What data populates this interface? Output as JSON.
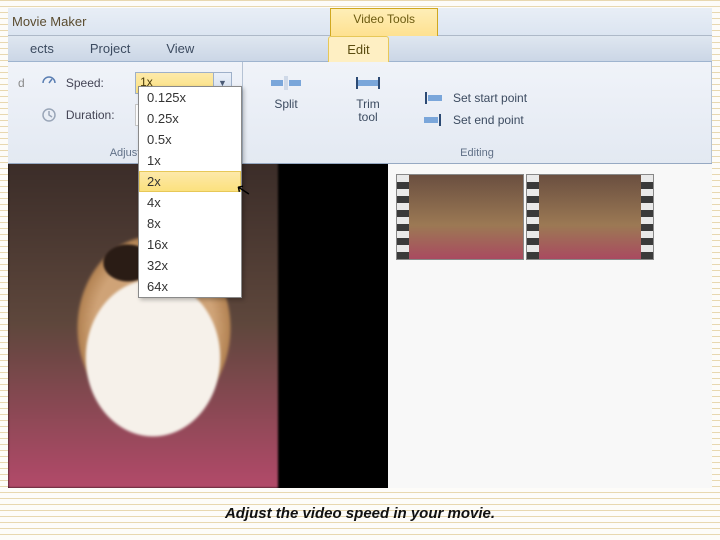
{
  "title": "Movie Maker",
  "context_tab": "Video Tools",
  "tabs": {
    "ects": "ects",
    "project": "Project",
    "view": "View",
    "edit": "Edit"
  },
  "adjust": {
    "speed_label": "Speed:",
    "speed_value": "1x",
    "duration_label": "Duration:",
    "truncated": "d",
    "group_label": "Adjust"
  },
  "speed_options": [
    "0.125x",
    "0.25x",
    "0.5x",
    "1x",
    "2x",
    "4x",
    "8x",
    "16x",
    "32x",
    "64x"
  ],
  "speed_hover_index": 4,
  "editing": {
    "split": "Split",
    "trim": "Trim\ntool",
    "start": "Set start point",
    "end": "Set end point",
    "group_label": "Editing"
  },
  "caption": "Adjust the video speed in your movie."
}
